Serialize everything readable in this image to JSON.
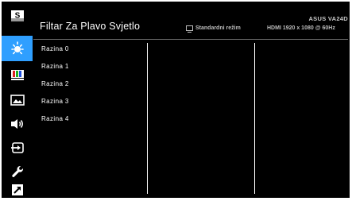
{
  "header": {
    "title": "Filtar Za Plavo Svjetlo",
    "model": "ASUS VA24D",
    "mode_label": "Standardni režim",
    "resolution": "HDMI 1920 x 1080 @ 60Hz"
  },
  "sidebar": {
    "items": [
      {
        "icon": "splendid-s-icon",
        "active": false
      },
      {
        "icon": "blue-light-filter-icon",
        "active": true
      },
      {
        "icon": "color-bars-icon",
        "active": false
      },
      {
        "icon": "image-icon",
        "active": false
      },
      {
        "icon": "sound-icon",
        "active": false
      },
      {
        "icon": "input-select-icon",
        "active": false
      },
      {
        "icon": "system-setup-icon",
        "active": false
      },
      {
        "icon": "shortcut-icon",
        "active": false
      }
    ]
  },
  "options": [
    {
      "label": "Razina 0"
    },
    {
      "label": "Razina 1"
    },
    {
      "label": "Razina 2"
    },
    {
      "label": "Razina 3"
    },
    {
      "label": "Razina 4"
    }
  ],
  "colors": {
    "background": "#000000",
    "accent": "#2f9fff",
    "text": "#ffffff"
  }
}
